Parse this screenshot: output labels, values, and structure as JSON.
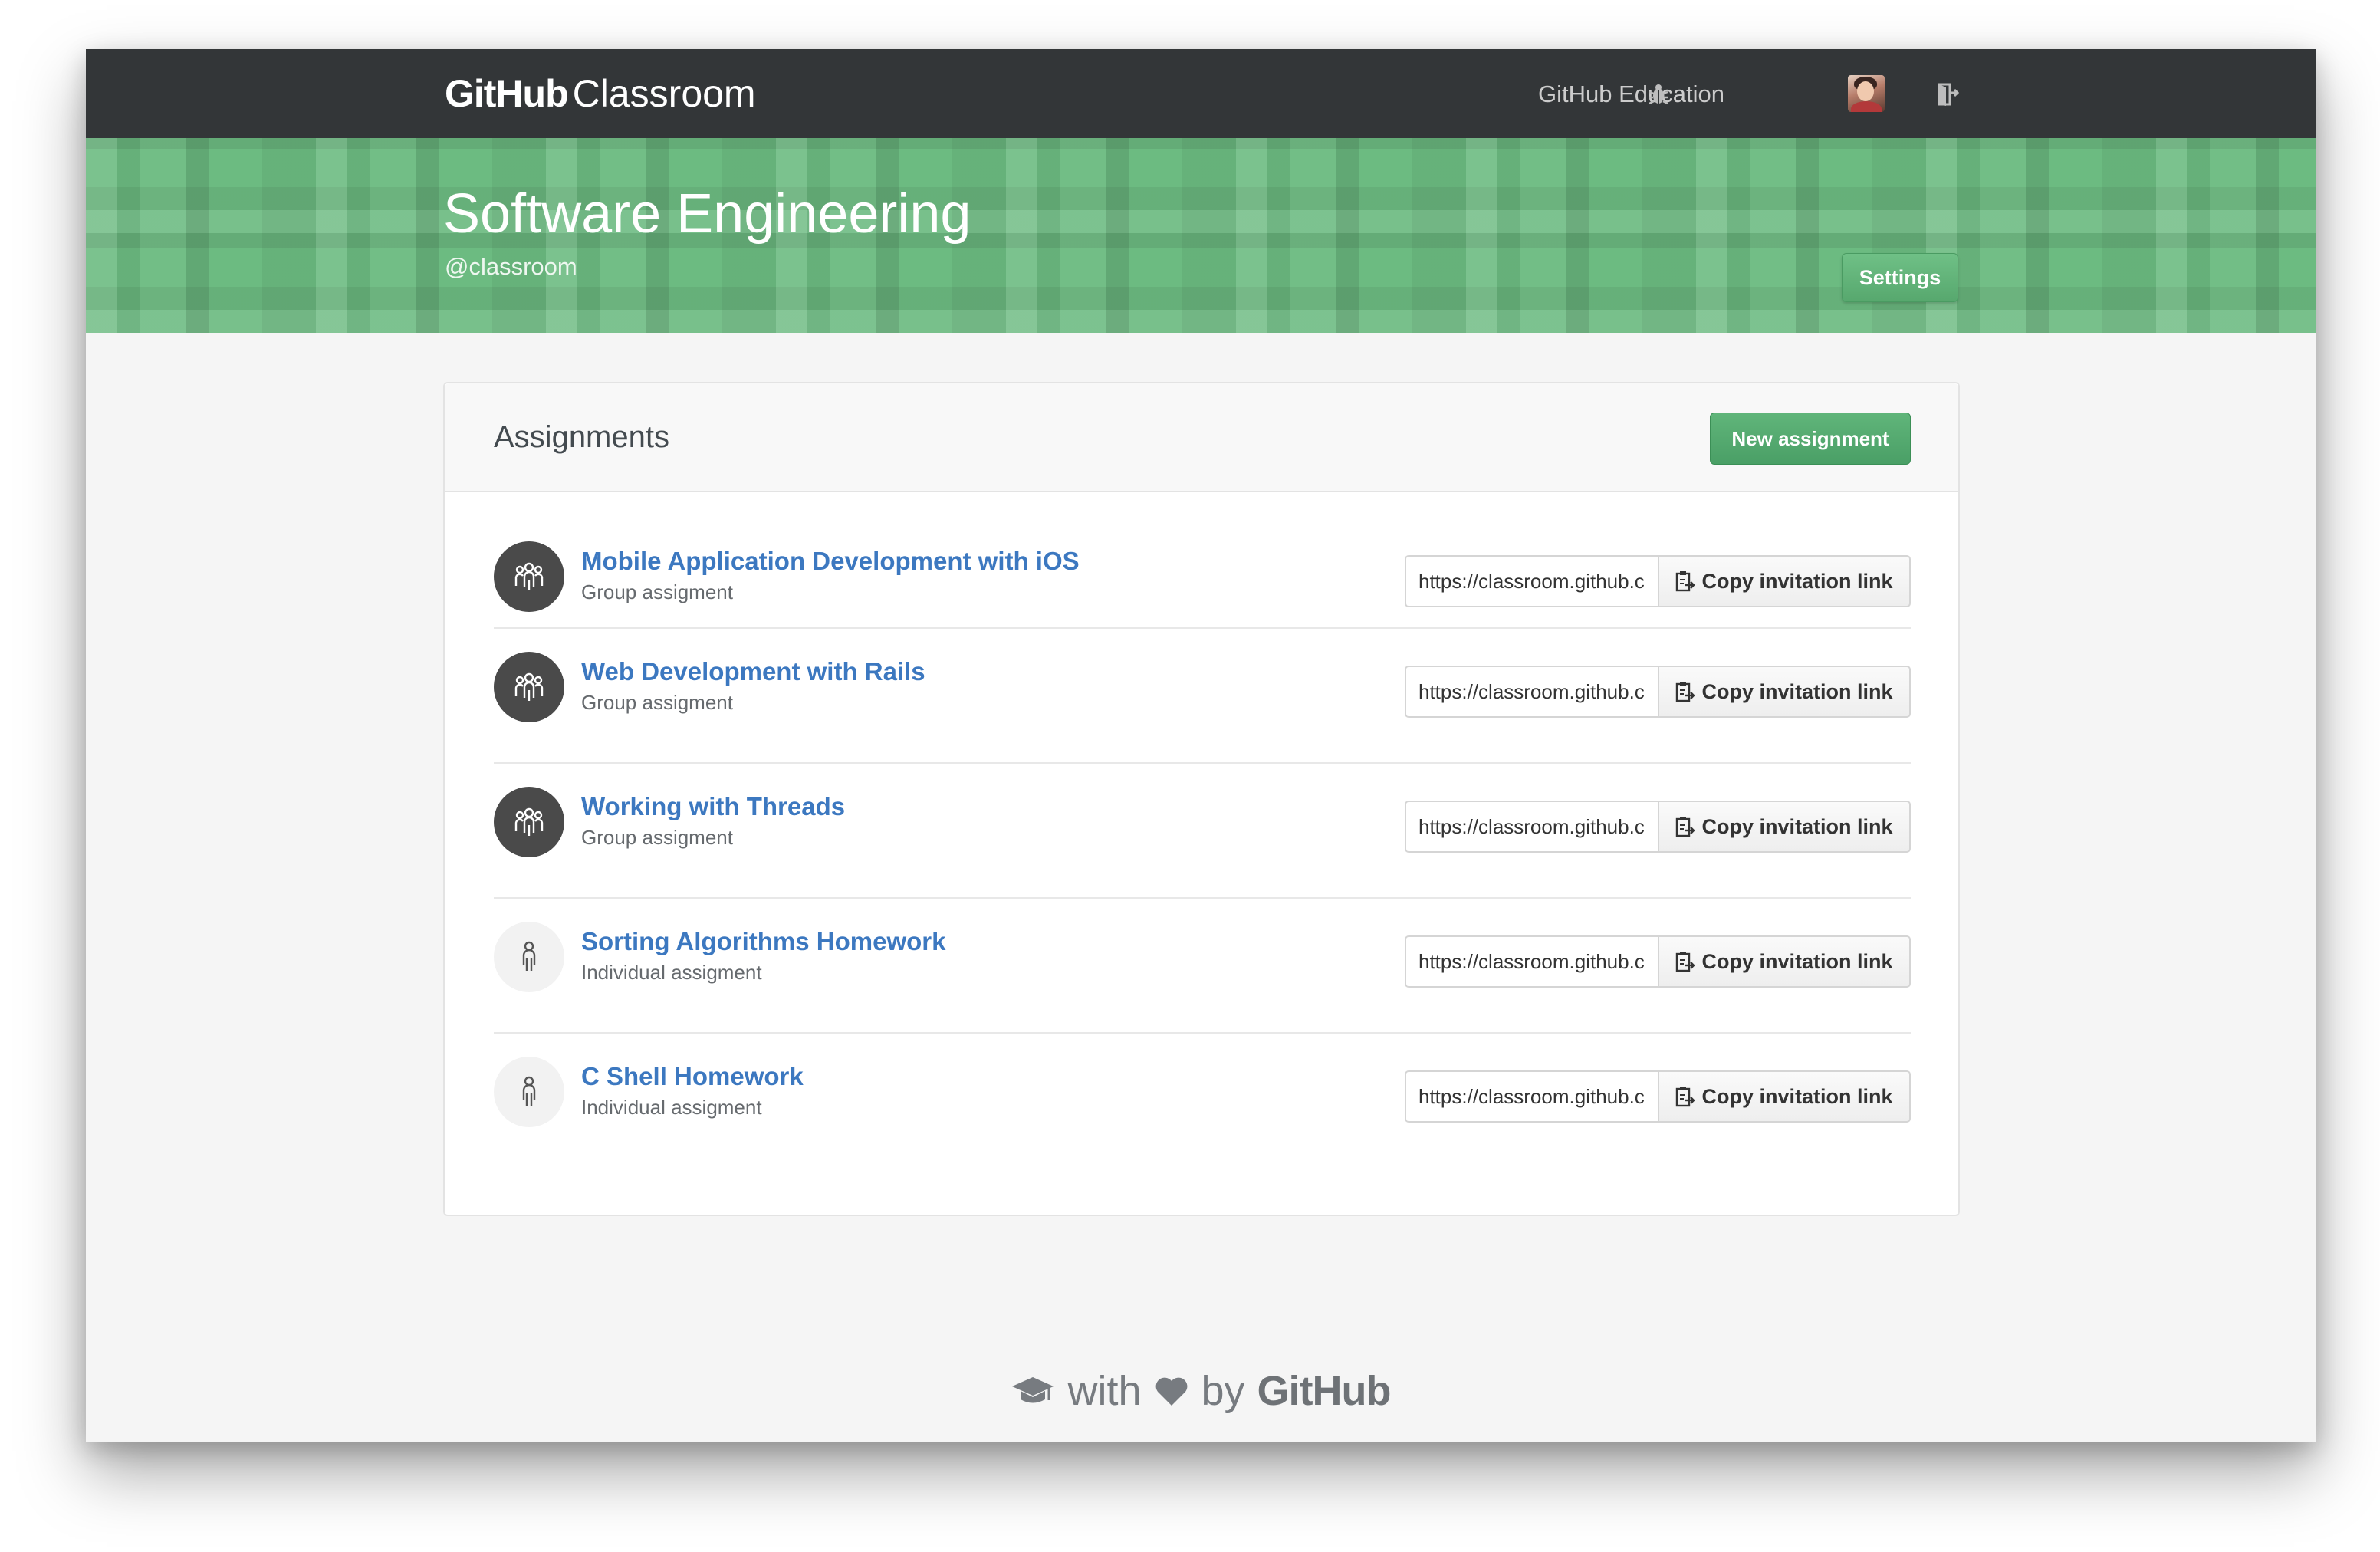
{
  "nav": {
    "brand_bold": "GitHub",
    "brand_light": "Classroom",
    "education_link": "GitHub Education"
  },
  "course": {
    "title": "Software Engineering",
    "handle": "@classroom",
    "settings_label": "Settings"
  },
  "assignments": {
    "title": "Assignments",
    "new_label": "New assignment",
    "copy_label": "Copy invitation link",
    "items": [
      {
        "name": "Mobile Application Development with iOS",
        "type": "Group assigment",
        "kind": "group",
        "link": "https://classroom.github.c"
      },
      {
        "name": "Web Development with Rails",
        "type": "Group assigment",
        "kind": "group",
        "link": "https://classroom.github.c"
      },
      {
        "name": "Working with Threads",
        "type": "Group assigment",
        "kind": "group",
        "link": "https://classroom.github.c"
      },
      {
        "name": "Sorting Algorithms Homework",
        "type": "Individual assigment",
        "kind": "individual",
        "link": "https://classroom.github.c"
      },
      {
        "name": "C Shell Homework",
        "type": "Individual assigment",
        "kind": "individual",
        "link": "https://classroom.github.c"
      }
    ]
  },
  "footer": {
    "with": "with",
    "by": "by",
    "github": "GitHub"
  },
  "colors": {
    "nav_bg": "#333638",
    "banner_green": "#6cbb81",
    "link_blue": "#3c78c0",
    "button_green": "#4a9f66"
  },
  "icons": {
    "bug": "bug-icon",
    "signout": "sign-out-icon",
    "group": "group-icon",
    "person": "person-icon",
    "clipboard": "clipboard-icon",
    "mortarboard": "mortarboard-icon",
    "heart": "heart-icon"
  }
}
